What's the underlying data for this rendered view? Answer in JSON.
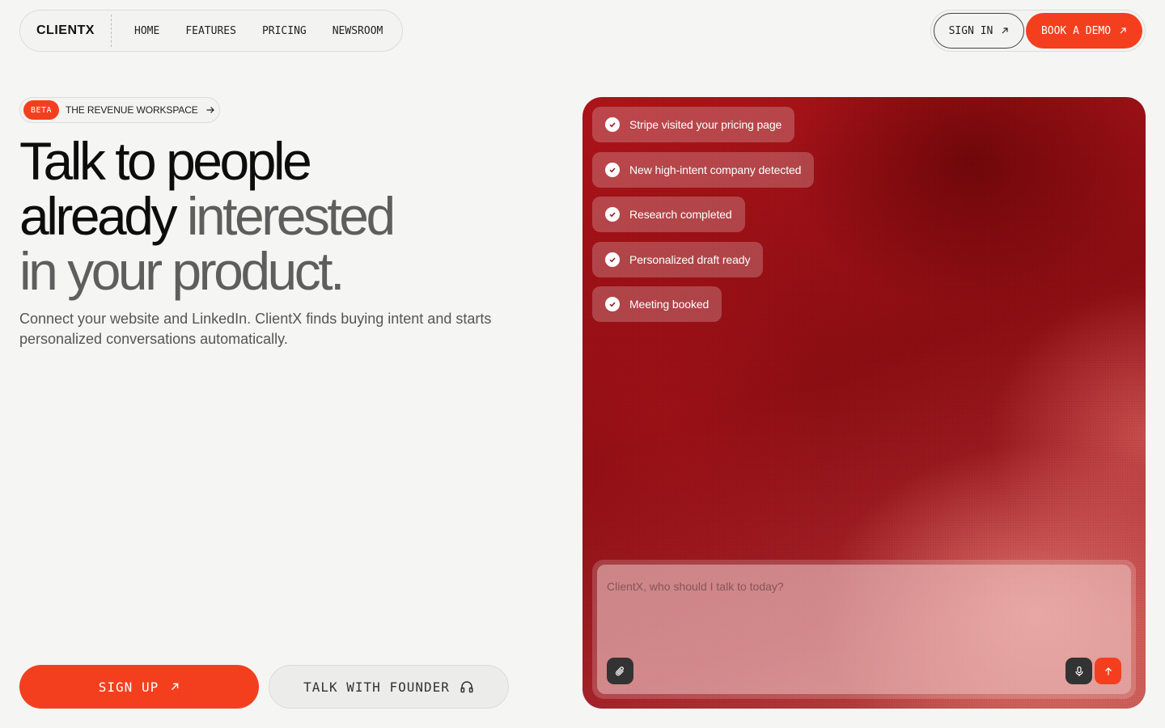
{
  "nav": {
    "brand": "CLIENTX",
    "links": [
      "HOME",
      "FEATURES",
      "PRICING",
      "NEWSROOM"
    ],
    "sign_in": "SIGN IN",
    "book_demo": "BOOK A DEMO"
  },
  "badge": {
    "tag": "BETA",
    "text": "THE REVENUE WORKSPACE"
  },
  "hero": {
    "line1": "Talk to people",
    "line2_dark": "already",
    "line2_gray": "interested",
    "line3": "in your product.",
    "subtext": "Connect your website and LinkedIn. ClientX finds buying intent and starts personalized conversations automatically."
  },
  "cta": {
    "sign_up": "SIGN UP",
    "talk_founder": "TALK WITH FOUNDER"
  },
  "events": [
    "Stripe visited your pricing page",
    "New high-intent company detected",
    "Research completed",
    "Personalized draft ready",
    "Meeting booked"
  ],
  "composer": {
    "placeholder": "ClientX, who should I talk to today?"
  },
  "colors": {
    "accent": "#f43f1f",
    "panel_dark": "#8d0e13",
    "panel_light": "#c65650"
  },
  "icons": {
    "sign_in": "arrow-up-right-icon",
    "book_demo": "arrow-up-right-icon",
    "badge": "arrow-right-icon",
    "sign_up": "arrow-up-right-icon",
    "talk_founder": "headphones-icon",
    "event": "check-icon",
    "attach": "paperclip-icon",
    "mic": "microphone-icon",
    "send": "arrow-up-icon"
  }
}
